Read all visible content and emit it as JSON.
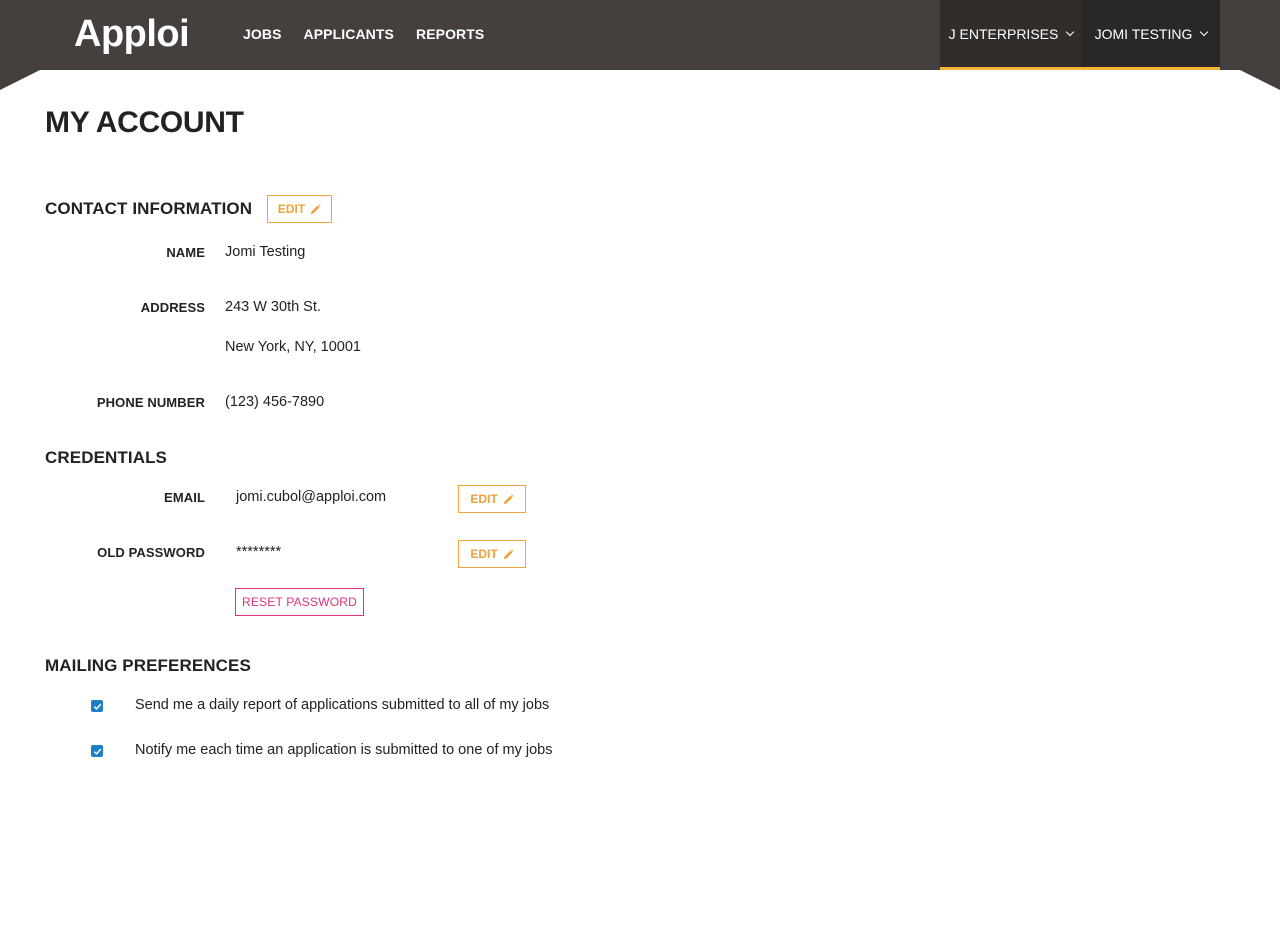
{
  "header": {
    "logo_text": "Apploi",
    "nav": [
      "JOBS",
      "APPLICANTS",
      "REPORTS"
    ],
    "org_menu": "J ENTERPRISES",
    "user_menu": "JOMI TESTING",
    "accent_color": "#f2b534",
    "bar_color": "#45403d"
  },
  "page": {
    "title": "MY ACCOUNT"
  },
  "contact": {
    "title": "CONTACT INFORMATION",
    "edit_label": "EDIT",
    "name_label": "NAME",
    "name": "Jomi Testing",
    "address_label": "ADDRESS",
    "address_line1": "243 W 30th St.",
    "address_line2": "New York, NY, 10001",
    "phone_label": "PHONE NUMBER",
    "phone": "(123) 456-7890"
  },
  "credentials": {
    "title": "CREDENTIALS",
    "email_label": "EMAIL",
    "email": "jomi.cubol@apploi.com",
    "email_edit_label": "EDIT",
    "password_label": "OLD PASSWORD",
    "password": "********",
    "password_edit_label": "EDIT",
    "reset_label": "RESET PASSWORD"
  },
  "mailing": {
    "title": "MAILING PREFERENCES",
    "options": [
      {
        "label": "Send me a daily report of applications submitted to all of my jobs",
        "checked": true
      },
      {
        "label": "Notify me each time an application is submitted to one of my jobs",
        "checked": true
      }
    ]
  },
  "colors": {
    "edit": "#f0a03a",
    "reset": "#e0327a",
    "checkbox": "#1f7fc4"
  }
}
